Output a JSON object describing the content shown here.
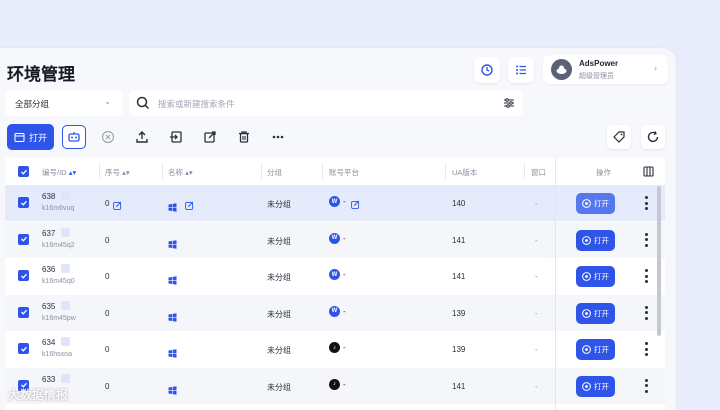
{
  "page": {
    "title": "环境管理"
  },
  "user": {
    "name": "AdsPower",
    "role": "超级管理员"
  },
  "filters": {
    "group_value": "全部分组",
    "search_placeholder": "搜索或新建搜索条件"
  },
  "toolbar": {
    "open_label": "打开"
  },
  "table": {
    "columns": [
      "编号/ID",
      "序号",
      "名称",
      "分组",
      "账号平台",
      "UA版本",
      "窗口",
      "操作"
    ],
    "rows": [
      {
        "num": "638",
        "id": "k16m6vuq",
        "seq": "0",
        "group": "未分组",
        "platform": "W",
        "platform_color": "#2e55e8",
        "ua": "140",
        "window": "-",
        "action": "打开",
        "selected": true
      },
      {
        "num": "637",
        "id": "k16m45q2",
        "seq": "0",
        "group": "未分组",
        "platform": "W",
        "platform_color": "#2e55e8",
        "ua": "141",
        "window": "-",
        "action": "打开",
        "selected": true
      },
      {
        "num": "636",
        "id": "k16m45q0",
        "seq": "0",
        "group": "未分组",
        "platform": "W",
        "platform_color": "#2e55e8",
        "ua": "141",
        "window": "-",
        "action": "打开",
        "selected": true
      },
      {
        "num": "635",
        "id": "k16m45pw",
        "seq": "0",
        "group": "未分组",
        "platform": "W",
        "platform_color": "#2e55e8",
        "ua": "139",
        "window": "-",
        "action": "打开",
        "selected": true
      },
      {
        "num": "634",
        "id": "k16hsxoa",
        "seq": "0",
        "group": "未分组",
        "platform": "♪",
        "platform_color": "#111111",
        "ua": "139",
        "window": "-",
        "action": "打开",
        "selected": true
      },
      {
        "num": "633",
        "id": "",
        "seq": "0",
        "group": "未分组",
        "platform": "♪",
        "platform_color": "#111111",
        "ua": "141",
        "window": "-",
        "action": "打开",
        "selected": true
      }
    ]
  },
  "dash": "-",
  "watermark": "大数据情报",
  "colors": {
    "accent": "#2e55e8",
    "background": "#e9edfb"
  }
}
